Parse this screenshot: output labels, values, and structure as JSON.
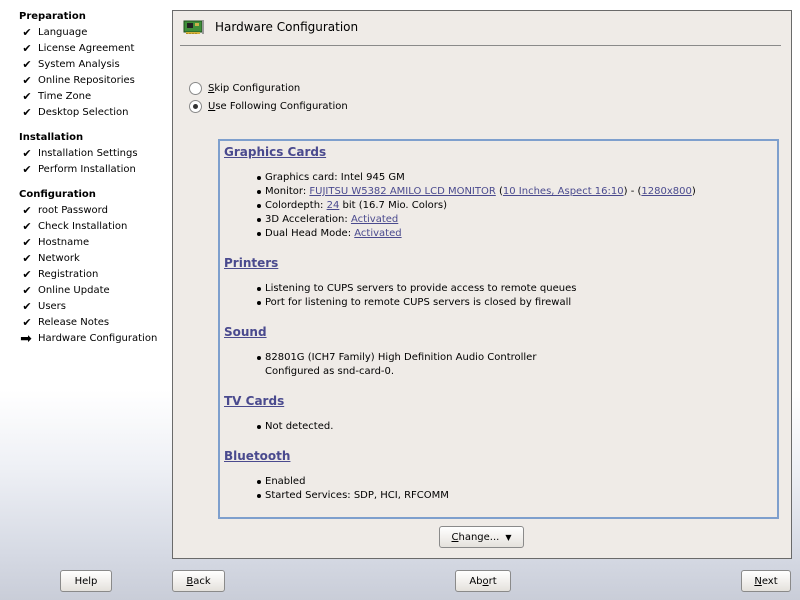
{
  "sidebar": {
    "sections": [
      {
        "heading": "Preparation",
        "items": [
          {
            "label": "Language",
            "status": "done"
          },
          {
            "label": "License Agreement",
            "status": "done"
          },
          {
            "label": "System Analysis",
            "status": "done"
          },
          {
            "label": "Online Repositories",
            "status": "done"
          },
          {
            "label": "Time Zone",
            "status": "done"
          },
          {
            "label": "Desktop Selection",
            "status": "done"
          }
        ]
      },
      {
        "heading": "Installation",
        "items": [
          {
            "label": "Installation Settings",
            "status": "done"
          },
          {
            "label": "Perform Installation",
            "status": "done"
          }
        ]
      },
      {
        "heading": "Configuration",
        "items": [
          {
            "label": "root Password",
            "status": "done"
          },
          {
            "label": "Check Installation",
            "status": "done"
          },
          {
            "label": "Hostname",
            "status": "done"
          },
          {
            "label": "Network",
            "status": "done"
          },
          {
            "label": "Registration",
            "status": "done"
          },
          {
            "label": "Online Update",
            "status": "done"
          },
          {
            "label": "Users",
            "status": "done"
          },
          {
            "label": "Release Notes",
            "status": "done"
          },
          {
            "label": "Hardware Configuration",
            "status": "current"
          }
        ]
      }
    ],
    "done_glyph": "✔",
    "current_glyph": "➡"
  },
  "main": {
    "title": "Hardware Configuration",
    "icon": "hardware-card-icon",
    "radios": [
      {
        "accel": "S",
        "rest": "kip Configuration",
        "checked": false
      },
      {
        "accel": "U",
        "rest": "se Following Configuration",
        "checked": true
      }
    ],
    "summary": {
      "graphics": {
        "title": "Graphics Cards",
        "card": "Graphics card: Intel 945 GM",
        "monitor_prefix": "Monitor: ",
        "monitor_link": "FUJITSU W5382 AMILO LCD MONITOR",
        "monitor_open": " (",
        "monitor_size_link": "10 Inches, Aspect 16:10",
        "monitor_mid": ") - (",
        "monitor_res_link": "1280x800",
        "monitor_close": ")",
        "depth_prefix": "Colordepth: ",
        "depth_link": "24",
        "depth_suffix": " bit (16.7 Mio. Colors)",
        "accel_prefix": "3D Acceleration: ",
        "accel_link": "Activated",
        "dual_prefix": "Dual Head Mode: ",
        "dual_link": "Activated"
      },
      "printers": {
        "title": "Printers",
        "items": [
          "Listening to CUPS servers to provide access to remote queues",
          "Port for listening to remote CUPS servers is closed by firewall"
        ]
      },
      "sound": {
        "title": "Sound",
        "device": "82801G (ICH7 Family) High Definition Audio Controller",
        "configured": "Configured as snd-card-0."
      },
      "tv": {
        "title": "TV Cards",
        "items": [
          "Not detected."
        ]
      },
      "bluetooth": {
        "title": "Bluetooth",
        "items": [
          "Enabled",
          "Started Services: SDP, HCI, RFCOMM"
        ]
      }
    },
    "change_button": {
      "accel": "C",
      "rest": "hange...",
      "arrow": "▼"
    }
  },
  "footer": {
    "help": "Help",
    "back": {
      "accel": "B",
      "rest": "ack"
    },
    "abort": {
      "pre": "Ab",
      "accel": "o",
      "rest": "rt"
    },
    "next": {
      "accel": "N",
      "rest": "ext"
    }
  },
  "colors": {
    "link": "#4a4a8e",
    "summary_border": "#7e9fcd",
    "panel_bg": "#efebe7"
  }
}
